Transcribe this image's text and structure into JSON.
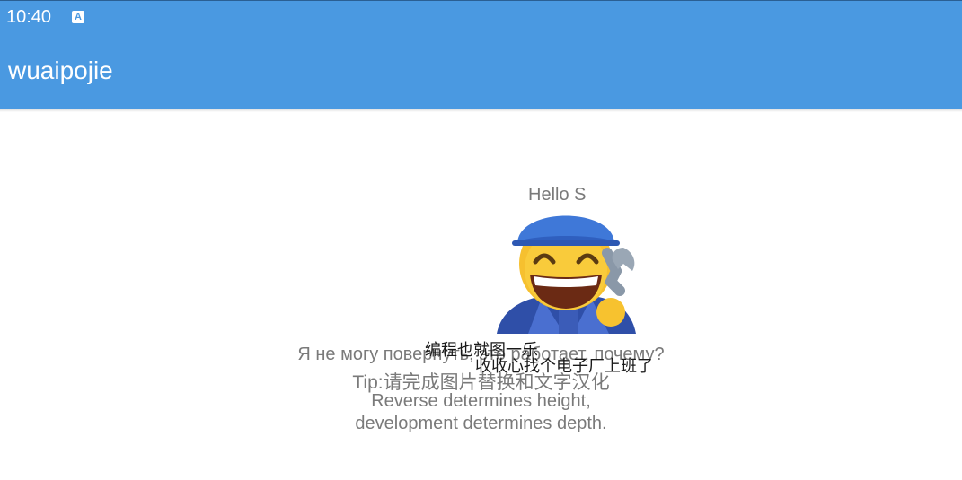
{
  "status": {
    "time": "10:40",
    "notif_icon": "a-icon"
  },
  "appbar": {
    "title": "wuaipojie"
  },
  "content": {
    "hello": "Hello S",
    "emoji_icon": "mechanic-emoji",
    "caption_line1": "编程也就图一乐",
    "caption_line2": "收收心找个电子厂上班了",
    "russian": "Я не могу повернуть, это работает, почему?",
    "tip": "Tip:请完成图片替换和文字汉化",
    "reverse_line1": "Reverse determines height,",
    "reverse_line2": "development determines depth."
  },
  "colors": {
    "appbar": "#4a99e1",
    "text_gray": "#7a7a7a"
  }
}
